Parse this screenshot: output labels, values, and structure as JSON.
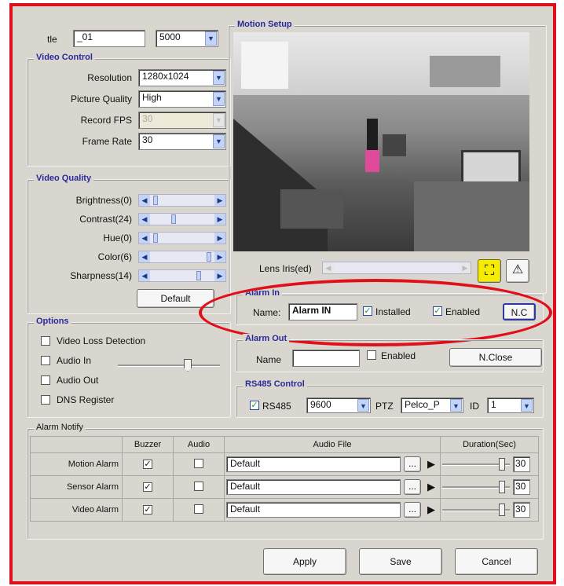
{
  "title": {
    "label": "tle",
    "value": "_01",
    "port": "5000"
  },
  "video_control": {
    "title": "Video Control",
    "rows": [
      {
        "label": "Resolution",
        "value": "1280x1024",
        "disabled": false
      },
      {
        "label": "Picture Quality",
        "value": "High",
        "disabled": false
      },
      {
        "label": "Record FPS",
        "value": "30",
        "disabled": true
      },
      {
        "label": "Frame Rate",
        "value": "30",
        "disabled": false
      }
    ]
  },
  "video_quality": {
    "title": "Video Quality",
    "rows": [
      {
        "label": "Brightness(0)",
        "position": 0.05
      },
      {
        "label": "Contrast(24)",
        "position": 0.35
      },
      {
        "label": "Hue(0)",
        "position": 0.05
      },
      {
        "label": "Color(6)",
        "position": 0.92
      },
      {
        "label": "Sharpness(14)",
        "position": 0.75
      }
    ],
    "default_button": "Default"
  },
  "options": {
    "title": "Options",
    "items": [
      {
        "label": "Video Loss Detection",
        "checked": false
      },
      {
        "label": "Audio In",
        "checked": false
      },
      {
        "label": "Audio Out",
        "checked": false
      },
      {
        "label": "DNS Register",
        "checked": false
      }
    ],
    "audio_in_level": 0.7
  },
  "motion_setup": {
    "title": "Motion Setup",
    "lens_label": "Lens Iris(ed)",
    "lens_position": 0.0
  },
  "alarm_in": {
    "title": "Alarm In",
    "name_label": "Name:",
    "name_value": "Alarm IN",
    "installed_label": "Installed",
    "installed_checked": true,
    "enabled_label": "Enabled",
    "enabled_checked": true,
    "nc_button": "N.C"
  },
  "alarm_out": {
    "title": "Alarm Out",
    "name_label": "Name",
    "name_value": "",
    "enabled_label": "Enabled",
    "enabled_checked": false,
    "button": "N.Close"
  },
  "rs485": {
    "title": "RS485 Control",
    "rs485_label": "RS485",
    "rs485_checked": true,
    "baud": "9600",
    "ptz_label": "PTZ",
    "ptz_value": "Pelco_P",
    "id_label": "ID",
    "id_value": "1"
  },
  "alarm_notify": {
    "title": "Alarm Notify",
    "columns": [
      "Buzzer",
      "Audio",
      "Audio File",
      "Duration(Sec)"
    ],
    "rows": [
      {
        "name": "Motion Alarm",
        "buzzer": true,
        "audio": false,
        "file": "Default",
        "duration": "30",
        "level": 0.95
      },
      {
        "name": "Sensor Alarm",
        "buzzer": true,
        "audio": false,
        "file": "Default",
        "duration": "30",
        "level": 0.95
      },
      {
        "name": "Video Alarm",
        "buzzer": true,
        "audio": false,
        "file": "Default",
        "duration": "30",
        "level": 0.95
      }
    ],
    "browse_label": "...",
    "play_label": "▶"
  },
  "buttons": {
    "apply": "Apply",
    "save": "Save",
    "cancel": "Cancel"
  },
  "colors": {
    "highlight": "#e0101a",
    "accent": "#ffff00"
  }
}
